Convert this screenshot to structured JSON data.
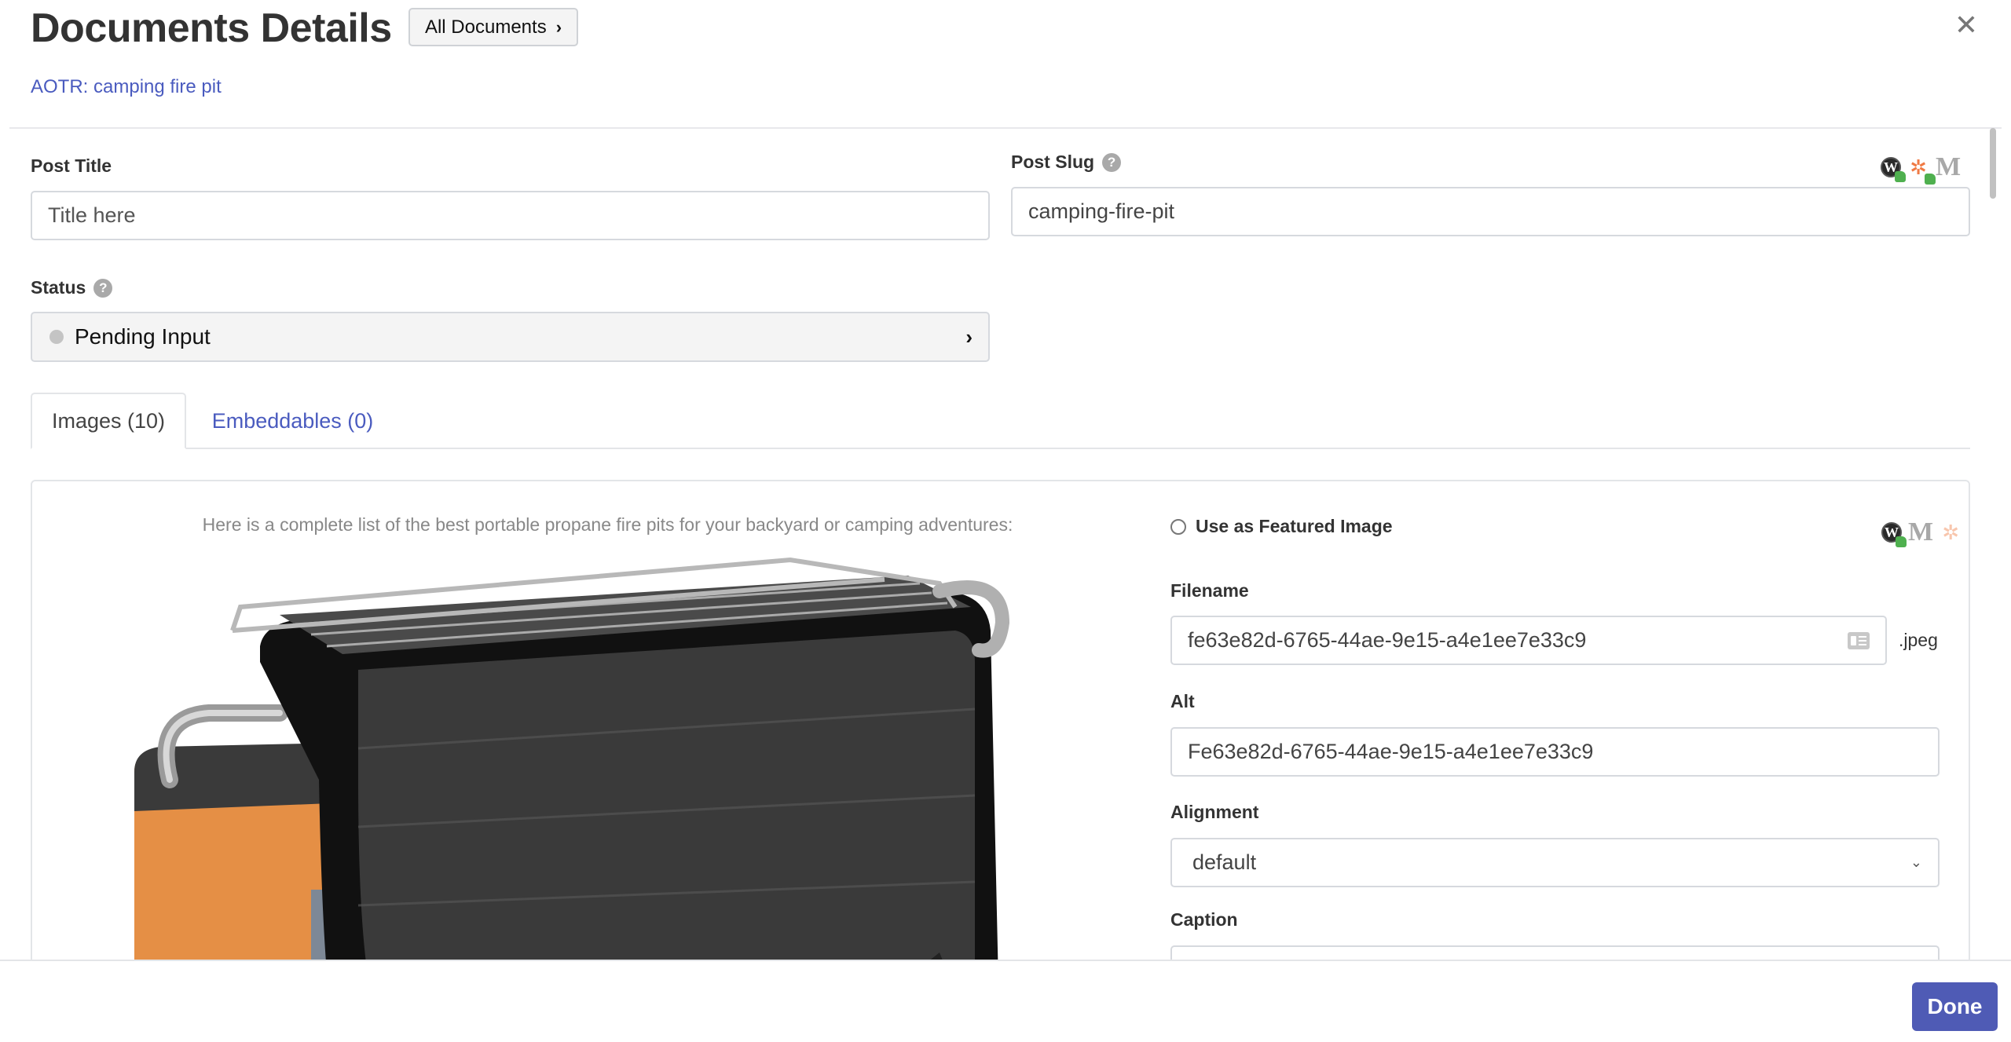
{
  "header": {
    "title": "Documents Details",
    "all_documents_label": "All Documents",
    "all_documents_chevron": "›",
    "close_glyph": "✕",
    "document_link": "AOTR: camping fire pit"
  },
  "form": {
    "post_title": {
      "label": "Post Title",
      "placeholder": "Title here",
      "value": ""
    },
    "post_slug": {
      "label": "Post Slug",
      "help": "?",
      "value": "camping-fire-pit",
      "platforms": [
        {
          "name": "wordpress",
          "glyph": "W",
          "approved": true
        },
        {
          "name": "hubspot",
          "glyph": "ℌ",
          "approved": true
        },
        {
          "name": "medium",
          "glyph": "M",
          "approved": false
        }
      ]
    },
    "status": {
      "label": "Status",
      "help": "?",
      "value": "Pending Input",
      "chevron": "›",
      "dot_color": "#c4c4c4"
    }
  },
  "tabs": [
    {
      "label": "Images (10)",
      "active": true
    },
    {
      "label": "Embeddables (0)",
      "active": false
    }
  ],
  "image_card": {
    "caption_text": "Here is a complete list of the best portable propane fire pits for your backyard or camping adventures:",
    "product_image_alt": "portable propane fire pit with orange side panel and black mesh body",
    "use_as_featured": {
      "label": "Use as Featured Image",
      "checked": false
    },
    "platforms": [
      {
        "name": "wordpress",
        "glyph": "W",
        "approved": true
      },
      {
        "name": "medium",
        "glyph": "M",
        "approved": false
      },
      {
        "name": "hubspot",
        "glyph": "ℌ",
        "approved": false
      }
    ],
    "filename": {
      "label": "Filename",
      "value": "fe63e82d-6765-44ae-9e15-a4e1ee7e33c9",
      "extension": ".jpeg"
    },
    "alt": {
      "label": "Alt",
      "value": "Fe63e82d-6765-44ae-9e15-a4e1ee7e33c9"
    },
    "alignment": {
      "label": "Alignment",
      "value": "default",
      "chevron": "⌄"
    },
    "caption": {
      "label": "Caption",
      "value": ""
    }
  },
  "footer": {
    "done_label": "Done"
  },
  "colors": {
    "accent": "#4f5bb5",
    "link": "#4a5bbf",
    "approved_green": "#4fb04f",
    "hubspot_orange": "#f07a44"
  }
}
